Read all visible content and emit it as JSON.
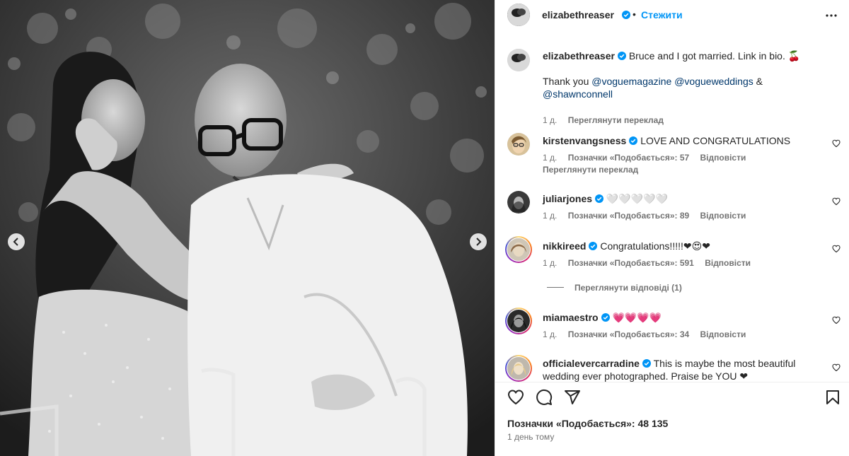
{
  "colors": {
    "accent": "#0095f6",
    "text": "#262626",
    "muted": "#737373",
    "mention": "#00376b"
  },
  "post": {
    "author": "elizabethreaser",
    "follow_label": "Стежити",
    "caption_main": "Bruce and I got married. Link in bio. 🍒",
    "caption_thanks": "Thank you",
    "mentions": [
      "@voguemagazine",
      "@vogueweddings",
      "@shawnconnell"
    ],
    "caption_and": "&",
    "time_short": "1 д.",
    "translate_label": "Переглянути переклад"
  },
  "comments": [
    {
      "user": "kirstenvangsness",
      "text": "LOVE AND CONGRATULATIONS",
      "time": "1 д.",
      "likes": "Позначки «Подобається»: 57",
      "reply": "Відповісти",
      "translate": "Переглянути переклад"
    },
    {
      "user": "juliarjones",
      "text": "🤍🤍🤍🤍🤍",
      "time": "1 д.",
      "likes": "Позначки «Подобається»: 89",
      "reply": "Відповісти"
    },
    {
      "user": "nikkireed",
      "text": "Congratulations!!!!!❤😍❤",
      "time": "1 д.",
      "likes": "Позначки «Подобається»: 591",
      "reply": "Відповісти",
      "view_replies": "Переглянути відповіді (1)"
    },
    {
      "user": "miamaestro",
      "text": "💗💗💗💗",
      "time": "1 д.",
      "likes": "Позначки «Подобається»: 34",
      "reply": "Відповісти"
    },
    {
      "user": "officialevercarradine",
      "text": "This is maybe the most beautiful wedding ever photographed. Praise be YOU ❤"
    }
  ],
  "footer": {
    "likes_label": "Позначки «Подобається»: 48 135",
    "time_label": "1 день тому"
  },
  "icons": [
    "more-icon",
    "heart-icon",
    "comment-icon",
    "share-icon",
    "bookmark-icon",
    "verified-icon",
    "chevron-left-icon",
    "chevron-right-icon"
  ]
}
